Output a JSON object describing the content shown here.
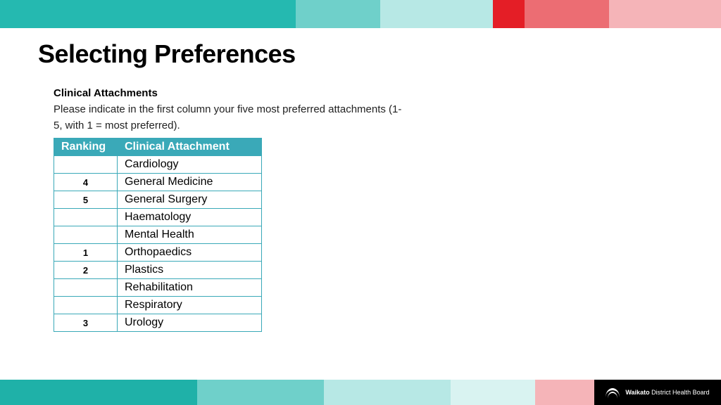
{
  "colors": {
    "top": [
      "#25b9b0",
      "#6fd0ca",
      "#b7e8e5",
      "#e41e26",
      "#ec6d73",
      "#f5b4b8"
    ],
    "topWidths": [
      420,
      120,
      160,
      45,
      120,
      159
    ],
    "bottom": [
      "#1fb1a8",
      "#6fd0ca",
      "#b7e8e5",
      "#d9f3f1",
      "#f5b4b8",
      "#000000"
    ],
    "bottomWidths": [
      280,
      180,
      180,
      120,
      84,
      180
    ]
  },
  "title": "Selecting Preferences",
  "section": {
    "heading": "Clinical Attachments",
    "desc": "Please indicate in the first column your five most preferred attachments (1-5, with 1 = most preferred)."
  },
  "table": {
    "headers": {
      "rank": "Ranking",
      "attachment": "Clinical Attachment"
    },
    "rows": [
      {
        "rank": "",
        "attachment": "Cardiology"
      },
      {
        "rank": "4",
        "attachment": "General Medicine"
      },
      {
        "rank": "5",
        "attachment": "General Surgery"
      },
      {
        "rank": "",
        "attachment": "Haematology"
      },
      {
        "rank": "",
        "attachment": "Mental Health"
      },
      {
        "rank": "1",
        "attachment": "Orthopaedics"
      },
      {
        "rank": "2",
        "attachment": "Plastics"
      },
      {
        "rank": "",
        "attachment": "Rehabilitation"
      },
      {
        "rank": "",
        "attachment": "Respiratory"
      },
      {
        "rank": "3",
        "attachment": "Urology"
      }
    ]
  },
  "logo": {
    "bold": "Waikato",
    "rest": " District Health Board"
  }
}
